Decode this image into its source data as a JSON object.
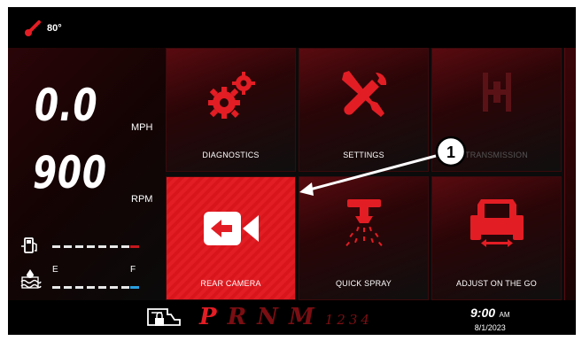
{
  "status": {
    "temperature": "80°"
  },
  "speed": {
    "value": "0.0",
    "unit": "MPH"
  },
  "rpm": {
    "value": "900",
    "unit": "RPM"
  },
  "gauges": {
    "fuel_level": 0.9,
    "def_label_empty": "E",
    "def_label_full": "F",
    "def_level": 0.9
  },
  "tiles": [
    {
      "label": "DIAGNOSTICS",
      "icon": "gears-icon"
    },
    {
      "label": "SETTINGS",
      "icon": "wrench-screwdriver-icon"
    },
    {
      "label": "TRANSMISSION",
      "icon": "transmission-icon"
    },
    {
      "label": "REAR CAMERA",
      "icon": "camera-icon"
    },
    {
      "label": "QUICK SPRAY",
      "icon": "sprayer-icon"
    },
    {
      "label": "ADJUST ON THE GO",
      "icon": "tractor-icon"
    }
  ],
  "gears": {
    "main": [
      "P",
      "R",
      "N",
      "M"
    ],
    "manual": [
      "1",
      "2",
      "3",
      "4"
    ]
  },
  "clock": {
    "time": "9:00",
    "ampm": "AM",
    "date": "8/1/2023"
  },
  "callout": {
    "number": "1"
  },
  "colors": {
    "accent": "#e31d24",
    "background": "#0b0b0b",
    "def_blue": "#2a9fe0"
  }
}
